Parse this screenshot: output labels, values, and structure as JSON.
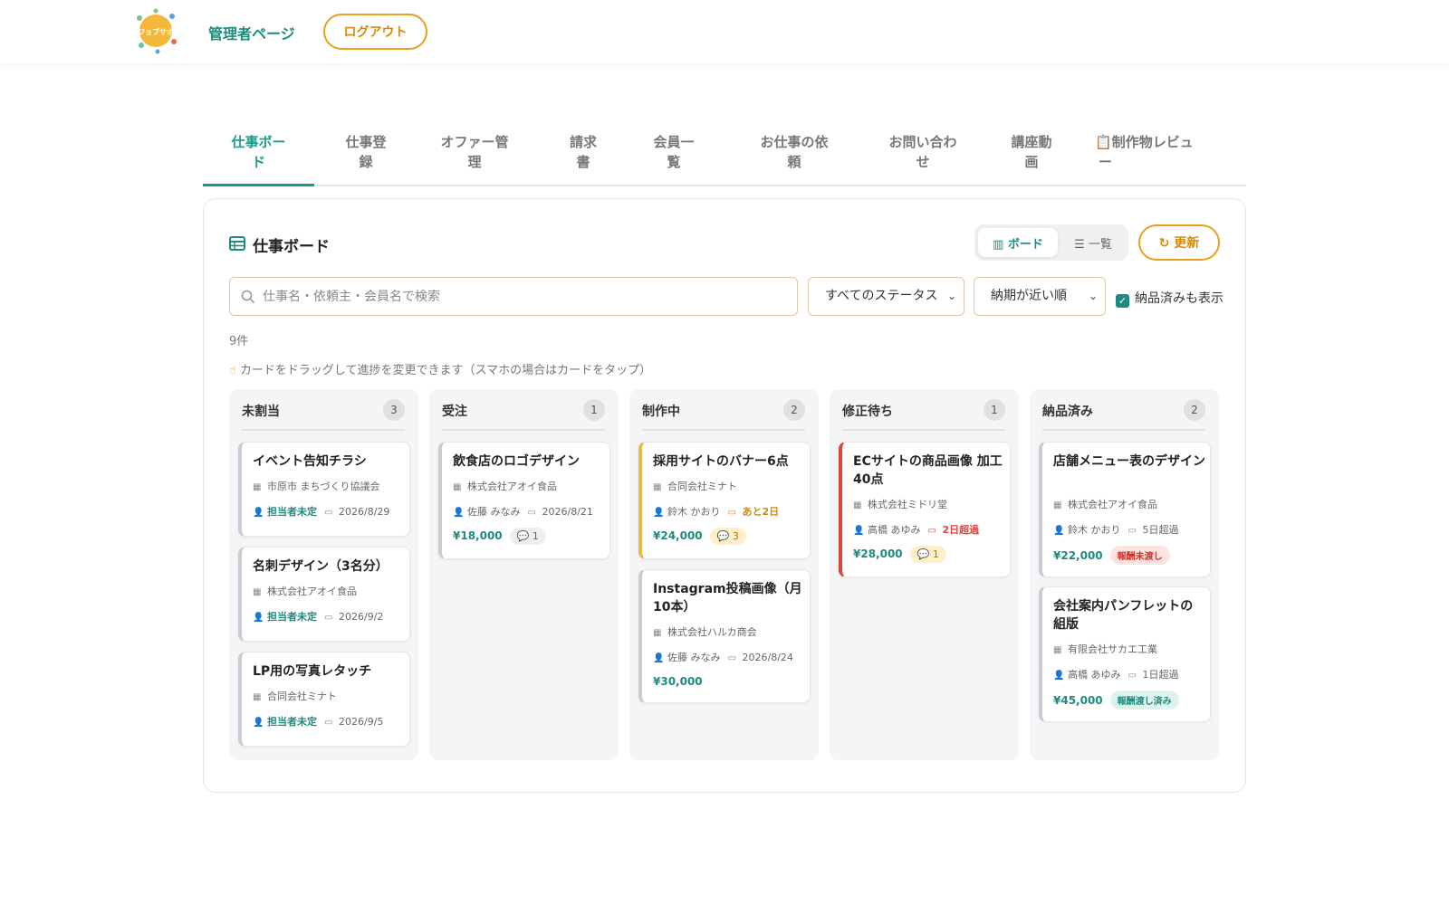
{
  "header": {
    "logo_text": "ジョブサポ",
    "admin_title": "管理者ページ",
    "logout_label": "ログアウト"
  },
  "tabs": [
    {
      "l1": "仕事ボー",
      "l2": "ド"
    },
    {
      "l1": "仕事登",
      "l2": "録"
    },
    {
      "l1": "オファー管",
      "l2": "理"
    },
    {
      "l1": "請求",
      "l2": "書"
    },
    {
      "l1": "会員一",
      "l2": "覧"
    },
    {
      "l1": "お仕事の依",
      "l2": "頼"
    },
    {
      "l1": "お問い合わ",
      "l2": "せ"
    },
    {
      "l1": "講座動",
      "l2": "画"
    },
    {
      "l1": "制作物レビュ",
      "l2": "ー"
    }
  ],
  "board": {
    "title": "仕事ボード",
    "view_board": "ボード",
    "view_list": "一覧",
    "refresh": "更新",
    "search_placeholder": "仕事名・依頼主・会員名で検索",
    "status_filter": "すべてのステータス",
    "sort": "納期が近い順",
    "show_delivered": "納品済みも表示",
    "count": "9件",
    "hint": "カードをドラッグして進捗を変更できます（スマホの場合はカードをタップ）"
  },
  "columns": [
    {
      "title": "未割当",
      "count": "3",
      "cards": [
        {
          "title": "イベント告知チラシ",
          "client": "市原市 まちづくり協議会",
          "assignee": "担当者未定",
          "due": "2026/8/29"
        },
        {
          "title": "名刺デザイン（3名分）",
          "client": "株式会社アオイ食品",
          "assignee": "担当者未定",
          "due": "2026/9/2"
        },
        {
          "title": "LP用の写真レタッチ",
          "client": "合同会社ミナト",
          "assignee": "担当者未定",
          "due": "2026/9/5"
        }
      ]
    },
    {
      "title": "受注",
      "count": "1",
      "cards": [
        {
          "title": "飲食店のロゴデザイン",
          "client": "株式会社アオイ食品",
          "assignee": "佐藤 みなみ",
          "due": "2026/8/21",
          "price": "¥18,000",
          "chats": "1"
        }
      ]
    },
    {
      "title": "制作中",
      "count": "2",
      "cards": [
        {
          "title": "採用サイトのバナー6点",
          "client": "合同会社ミナト",
          "assignee": "鈴木 かおり",
          "due": "あと2日",
          "price": "¥24,000",
          "chats": "3"
        },
        {
          "title": "Instagram投稿画像（月10本）",
          "client": "株式会社ハルカ商会",
          "assignee": "佐藤 みなみ",
          "due": "2026/8/24",
          "price": "¥30,000"
        }
      ]
    },
    {
      "title": "修正待ち",
      "count": "1",
      "cards": [
        {
          "title": "ECサイトの商品画像 加工40点",
          "client": "株式会社ミドリ堂",
          "assignee": "高橋 あゆみ",
          "due": "2日超過",
          "price": "¥28,000",
          "chats": "1"
        }
      ]
    },
    {
      "title": "納品済み",
      "count": "2",
      "cards": [
        {
          "title": "店舗メニュー表のデザイン",
          "client": "株式会社アオイ食品",
          "assignee": "鈴木 かおり",
          "due": "5日超過",
          "price": "¥22,000",
          "payment": "報酬未渡し"
        },
        {
          "title": "会社案内パンフレットの組版",
          "client": "有限会社サカエ工業",
          "assignee": "高橋 あゆみ",
          "due": "1日超過",
          "price": "¥45,000",
          "payment": "報酬渡し済み"
        }
      ]
    }
  ],
  "colors": {
    "accent": "#1f8a7e",
    "orange": "#e8a020",
    "late": "#d9463b"
  }
}
